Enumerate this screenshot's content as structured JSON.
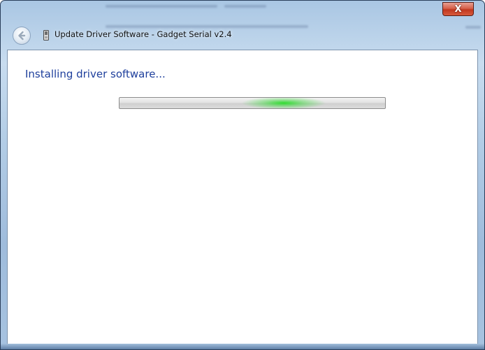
{
  "window": {
    "title": "Update Driver Software - Gadget Serial v2.4",
    "close_label": "X"
  },
  "icons": {
    "back": "back-arrow-icon",
    "device": "usb-device-icon",
    "close": "close-icon"
  },
  "content": {
    "heading": "Installing driver software...",
    "progress": {
      "mode": "indeterminate",
      "accent_color": "#22d322"
    }
  },
  "colors": {
    "heading": "#1e3f9c",
    "close_button": "#c8402a"
  }
}
